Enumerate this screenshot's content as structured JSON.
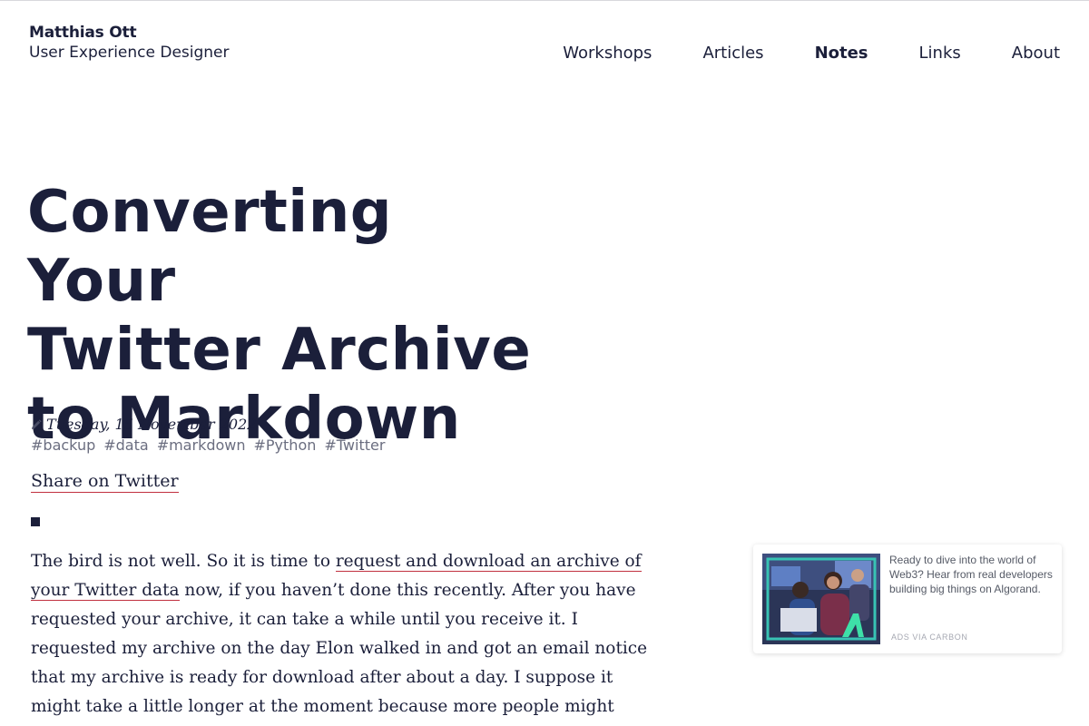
{
  "site": {
    "name": "Matthias Ott",
    "tagline": "User Experience Designer"
  },
  "nav": {
    "items": [
      {
        "label": "Workshops",
        "active": false
      },
      {
        "label": "Articles",
        "active": false
      },
      {
        "label": "Notes",
        "active": true
      },
      {
        "label": "Links",
        "active": false
      },
      {
        "label": "About",
        "active": false
      }
    ]
  },
  "article": {
    "title_lines": [
      "Converting Your",
      "Twitter Archive",
      "to Markdown"
    ],
    "date": "Tuesday, 15 November 2022",
    "date_icon": "pencil-icon",
    "tags": [
      "#backup",
      "#data",
      "#markdown",
      "#Python",
      "#Twitter"
    ],
    "share_label": "Share on Twitter",
    "body": {
      "intro": "The bird is not well. So it is time to ",
      "link_text": "request and download an archive of your Twitter data",
      "rest": " now, if you haven’t done this recently. After you have requested your archive, it can take a while until you receive it. I requested my archive on the day Elon walked in and got an email notice that my archive is ready for download after about a day. I suppose it might take a little longer at the mo­ment because more people might request their data."
    }
  },
  "ad": {
    "text": "Ready to dive into the world of Web3? Hear from real developers building big things on Algorand.",
    "via_label": "ADS VIA CARBON",
    "image_icon": "algorand-logo-icon"
  },
  "colors": {
    "text": "#1b1f3a",
    "link_underline": "#c1303f",
    "tag": "#6b6e80",
    "ad_frame": "#38c3b4"
  }
}
